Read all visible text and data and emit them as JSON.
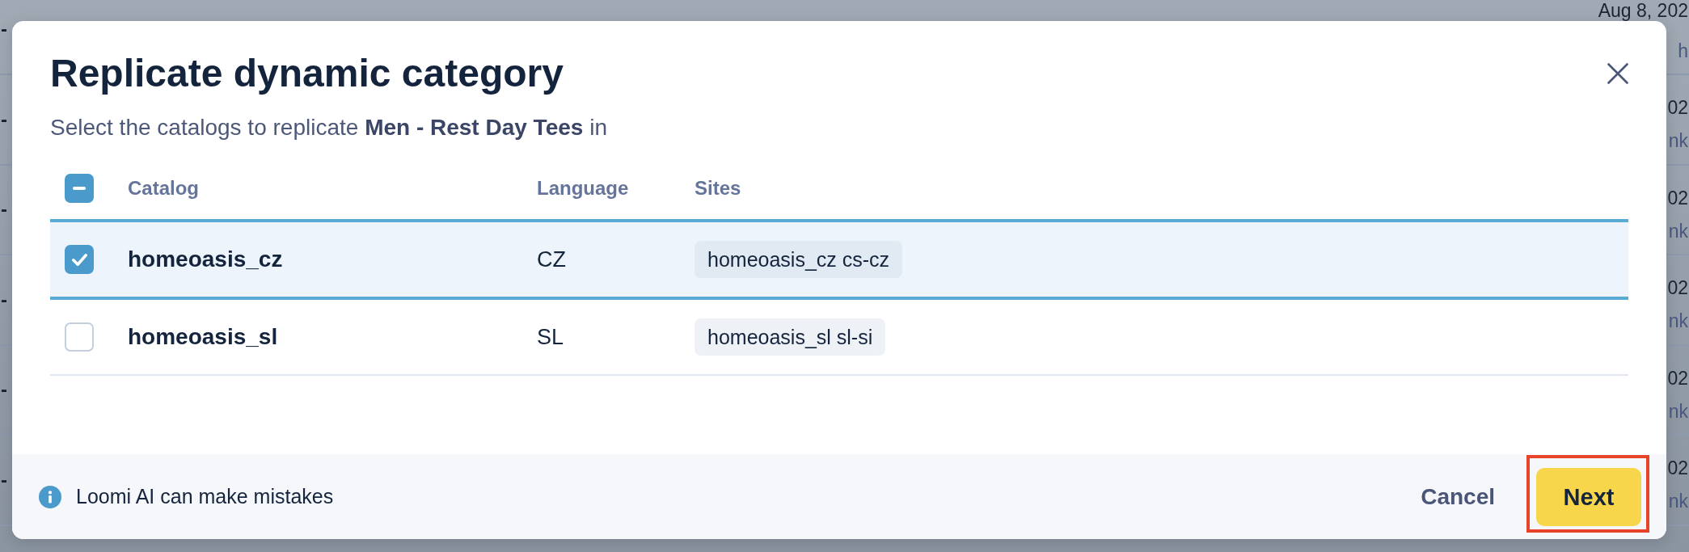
{
  "background_page": {
    "rows": [
      {
        "marker": "-",
        "date": "Aug 8, 202",
        "detail": "h"
      },
      {
        "marker": "-",
        "date": "02",
        "detail": "nk"
      },
      {
        "marker": "-",
        "date": "02",
        "detail": "nk"
      },
      {
        "marker": "-",
        "date": "02",
        "detail": "nk"
      },
      {
        "marker": "-",
        "date": "02",
        "detail": "nk"
      },
      {
        "marker": "-",
        "date": "02",
        "detail": "nk"
      }
    ]
  },
  "dialog": {
    "title": "Replicate dynamic category",
    "description": "Select the catalogs to replicate **Men - Rest Day Tees** in",
    "table": {
      "select_all": {
        "indeterminate": true
      },
      "columns": [
        "Catalog",
        "Language",
        "Sites"
      ],
      "rows": [
        {
          "checked": true,
          "catalog": "homeoasis_cz",
          "language": "CZ",
          "sites": [
            "homeoasis_cz cs-cz"
          ]
        },
        {
          "checked": false,
          "catalog": "homeoasis_sl",
          "language": "SL",
          "sites": [
            "homeoasis_sl sl-si"
          ]
        }
      ]
    },
    "footer": {
      "notice": "Loomi AI can make mistakes",
      "buttons": [
        {
          "label": "Cancel",
          "kind": "text",
          "highlighted": false
        },
        {
          "label": "Next",
          "kind": "primary",
          "highlighted": true
        }
      ]
    }
  }
}
